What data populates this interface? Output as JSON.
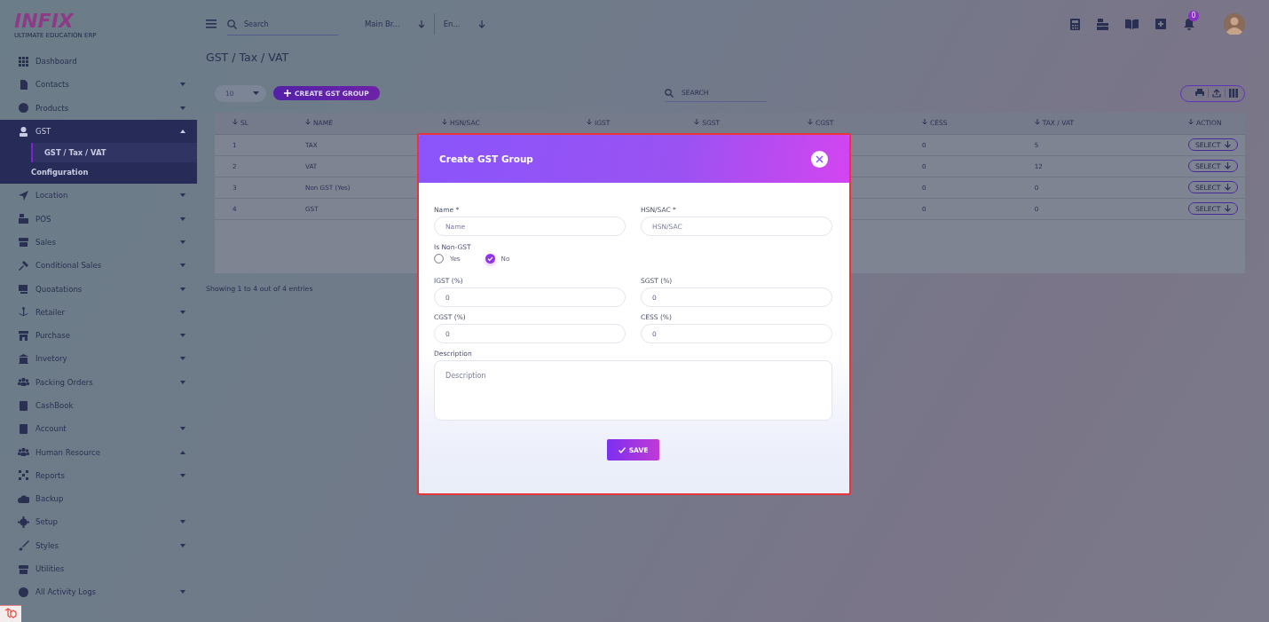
{
  "logo": {
    "text": "INFIX",
    "tagline": "ULTIMATE EDUCATION ERP"
  },
  "topbar": {
    "search": {
      "placeholder": "Search"
    },
    "branch": "Main Br...",
    "language": "En...",
    "notification_count": "0"
  },
  "sidebar": {
    "items": [
      {
        "label": "Dashboard"
      },
      {
        "label": "Contacts",
        "expanded": false
      },
      {
        "label": "Products",
        "expanded": false
      },
      {
        "label": "GST",
        "expanded": true,
        "children": [
          {
            "label": "GST / Tax / VAT",
            "selected": true
          },
          {
            "label": "Configuration",
            "selected": false
          }
        ]
      },
      {
        "label": "Location",
        "expanded": false
      },
      {
        "label": "POS",
        "expanded": false
      },
      {
        "label": "Sales",
        "expanded": false
      },
      {
        "label": "Conditional Sales",
        "expanded": false
      },
      {
        "label": "Quoatations",
        "expanded": false
      },
      {
        "label": "Retailer",
        "expanded": false
      },
      {
        "label": "Purchase",
        "expanded": false
      },
      {
        "label": "Invetory",
        "expanded": false
      },
      {
        "label": "Packing Orders",
        "expanded": false
      },
      {
        "label": "CashBook"
      },
      {
        "label": "Account",
        "expanded": false
      },
      {
        "label": "Human Resource",
        "expanded": true
      },
      {
        "label": "Reports",
        "expanded": false
      },
      {
        "label": "Backup"
      },
      {
        "label": "Setup",
        "expanded": false
      },
      {
        "label": "Styles",
        "expanded": false
      },
      {
        "label": "Utilities"
      },
      {
        "label": "All Activity Logs",
        "expanded": false
      }
    ]
  },
  "page_title": "GST / Tax / VAT",
  "toolbar": {
    "page_size": "10",
    "create_button": "CREATE GST GROUP",
    "search": {
      "placeholder": "SEARCH"
    }
  },
  "table": {
    "columns": [
      "SL",
      "NAME",
      "HSN/SAC",
      "IGST",
      "SGST",
      "CGST",
      "CESS",
      "TAX / VAT",
      "ACTION"
    ],
    "rows": [
      {
        "sl": "1",
        "name": "TAX",
        "cess": "0",
        "tax_vat": "5",
        "action": "SELECT"
      },
      {
        "sl": "2",
        "name": "VAT",
        "cess": "0",
        "tax_vat": "12",
        "action": "SELECT"
      },
      {
        "sl": "3",
        "name": "Non GST (Yes)",
        "cess": "0",
        "tax_vat": "0",
        "action": "SELECT"
      },
      {
        "sl": "4",
        "name": "GST",
        "cess": "0",
        "tax_vat": "0",
        "action": "SELECT"
      }
    ],
    "footer": "Showing 1 to 4 out of 4 entries"
  },
  "modal": {
    "title": "Create GST Group",
    "name": {
      "label": "Name *",
      "placeholder": "Name"
    },
    "hsn": {
      "label": "HSN/SAC *",
      "placeholder": "HSN/SAC"
    },
    "non_gst": {
      "label": "Is Non-GST",
      "options": [
        {
          "label": "Yes",
          "selected": false
        },
        {
          "label": "No",
          "selected": true
        }
      ]
    },
    "rates": [
      {
        "label": "IGST (%)",
        "value": "0"
      },
      {
        "label": "SGST (%)",
        "value": "0"
      },
      {
        "label": "CGST (%)",
        "value": "0"
      },
      {
        "label": "CESS (%)",
        "value": "0"
      }
    ],
    "description": {
      "label": "Description",
      "placeholder": "Description"
    },
    "save_button": "SAVE"
  }
}
